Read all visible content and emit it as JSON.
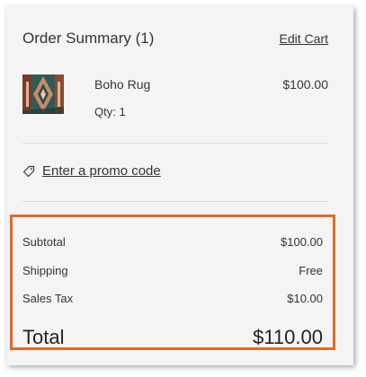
{
  "summary": {
    "title": "Order Summary (1)",
    "edit_cart": "Edit Cart"
  },
  "item": {
    "name": "Boho Rug",
    "qty": "Qty: 1",
    "price": "$100.00"
  },
  "promo": {
    "label": "Enter a promo code",
    "icon": "tag-icon"
  },
  "totals": {
    "subtotal_label": "Subtotal",
    "subtotal_value": "$100.00",
    "shipping_label": "Shipping",
    "shipping_value": "Free",
    "tax_label": "Sales Tax",
    "tax_value": "$10.00",
    "total_label": "Total",
    "total_value": "$110.00"
  },
  "colors": {
    "highlight_border": "#e06a26",
    "panel_bg": "#f4f4f4"
  }
}
